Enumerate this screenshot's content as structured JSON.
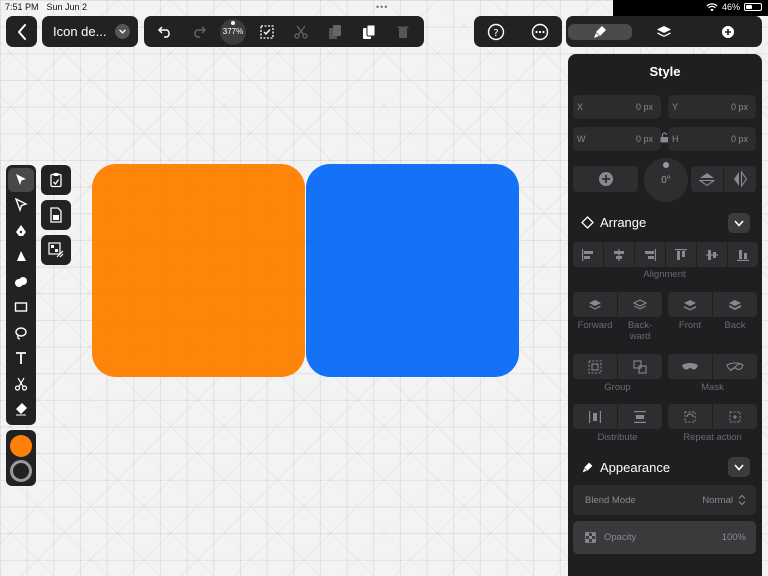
{
  "status_bar": {
    "time": "7:51 PM",
    "date": "Sun Jun 2",
    "battery": "46%",
    "battery_level": 0.46
  },
  "toolbar": {
    "back_icon": "chevron-left-icon",
    "document_title": "Icon de...",
    "zoom": "377%",
    "icons": [
      "undo-icon",
      "redo-icon",
      "zoom-indicator",
      "select-icon",
      "cut-icon",
      "copy-icon",
      "paste-icon",
      "trash-icon"
    ],
    "help_icons": [
      "help-icon",
      "more-icon"
    ]
  },
  "panel_tabs": [
    "style-tab",
    "layers-tab",
    "add-tab"
  ],
  "tools": [
    "selection-tool",
    "direct-selection-tool",
    "pen-tool",
    "vector-brush-tool",
    "shape-builder-tool",
    "rectangle-tool",
    "lasso-tool",
    "text-tool",
    "scissors-tool",
    "eraser-tool"
  ],
  "subtools": [
    "clipboard-icon",
    "paste-document-icon",
    "pattern-icon"
  ],
  "colors": {
    "fill": "#ff8008",
    "stroke": "#9a9a9a"
  },
  "canvas": {
    "shapes": [
      {
        "name": "orange-square",
        "color": "#ff7f00"
      },
      {
        "name": "blue-square",
        "color": "#0a6cf6"
      }
    ]
  },
  "panel": {
    "title": "Style",
    "fields": {
      "x": {
        "label": "X",
        "value": "0 px"
      },
      "y": {
        "label": "Y",
        "value": "0 px"
      },
      "w": {
        "label": "W",
        "value": "0 px"
      },
      "h": {
        "label": "H",
        "value": "0 px"
      }
    },
    "rotation": "0°",
    "arrange": {
      "title": "Arrange",
      "alignment_label": "Alignment",
      "forward": "Forward",
      "backward": "Back-\nward",
      "front": "Front",
      "back": "Back",
      "group": "Group",
      "mask": "Mask",
      "distribute": "Distribute",
      "repeat_action": "Repeat action"
    },
    "appearance": {
      "title": "Appearance",
      "blend_mode_label": "Blend Mode",
      "blend_mode_value": "Normal",
      "opacity_label": "Opacity",
      "opacity_value": "100%"
    }
  }
}
